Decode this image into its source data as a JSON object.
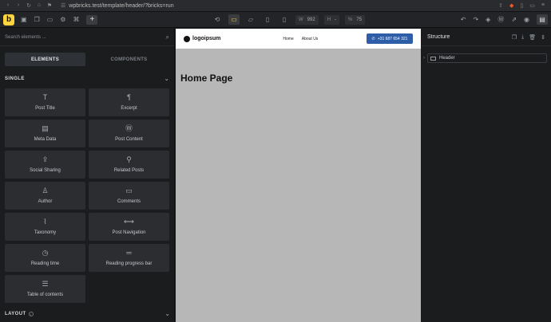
{
  "browser": {
    "url": "wpbricks.test/template/header/?bricks=run",
    "nav_icons": [
      "chevron-left-icon",
      "chevron-right-icon",
      "reload-icon",
      "home-icon",
      "bookmark-icon"
    ]
  },
  "toolbar": {
    "logo_letter": "b",
    "width_label": "W",
    "width_value": "992",
    "height_label": "H",
    "height_value": "-",
    "zoom_label": "%",
    "zoom_value": "75"
  },
  "left_panel": {
    "search_placeholder": "Search elements ...",
    "tabs": [
      "ELEMENTS",
      "COMPONENTS"
    ],
    "active_tab": "ELEMENTS",
    "section_single": "SINGLE",
    "section_layout": "LAYOUT",
    "elements": [
      {
        "label": "Post Title",
        "icon": "T"
      },
      {
        "label": "Excerpt",
        "icon": "¶"
      },
      {
        "label": "Meta Data",
        "icon": "▤"
      },
      {
        "label": "Post Content",
        "icon": "Ⓦ"
      },
      {
        "label": "Social Sharing",
        "icon": "⇪"
      },
      {
        "label": "Related Posts",
        "icon": "⚲"
      },
      {
        "label": "Author",
        "icon": "♙"
      },
      {
        "label": "Comments",
        "icon": "▭"
      },
      {
        "label": "Taxonomy",
        "icon": "⌇"
      },
      {
        "label": "Post Navigation",
        "icon": "⟷"
      },
      {
        "label": "Reading time",
        "icon": "◷"
      },
      {
        "label": "Reading progress bar",
        "icon": "═"
      },
      {
        "label": "Table of contents",
        "icon": "☰"
      }
    ]
  },
  "canvas": {
    "site_logo": "logoipsum",
    "nav": [
      "Home",
      "About Us"
    ],
    "cta": "+31 687 654 321",
    "page_title": "Home Page"
  },
  "right_panel": {
    "title": "Structure",
    "items": [
      {
        "label": "Header"
      }
    ]
  },
  "colors": {
    "accent": "#ffd53e",
    "cta_blue": "#2e5ea8",
    "panel_bg": "#1b1c1e",
    "canvas_bg": "#b7b7b7"
  }
}
